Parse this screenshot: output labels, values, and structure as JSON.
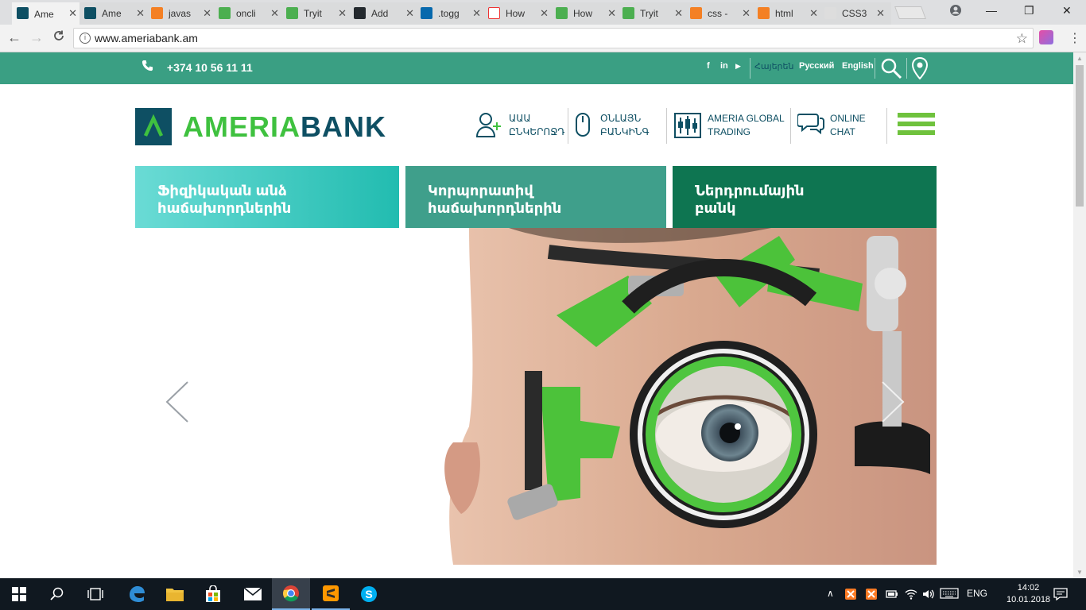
{
  "browser": {
    "tabs": [
      {
        "label": "Ame",
        "icon": "ameria-favicon",
        "active": true
      },
      {
        "label": "Ame",
        "icon": "ameria-favicon"
      },
      {
        "label": "javas",
        "icon": "stackoverflow-icon"
      },
      {
        "label": "oncli",
        "icon": "w3schools-icon"
      },
      {
        "label": "Tryit",
        "icon": "w3schools-icon"
      },
      {
        "label": "Add",
        "icon": "github-icon"
      },
      {
        "label": ".togg",
        "icon": "jquery-icon"
      },
      {
        "label": "How",
        "icon": "cv-icon"
      },
      {
        "label": "How",
        "icon": "w3schools-icon"
      },
      {
        "label": "Tryit",
        "icon": "w3schools-icon"
      },
      {
        "label": "css -",
        "icon": "stackoverflow-icon"
      },
      {
        "label": "html",
        "icon": "stackoverflow-icon"
      },
      {
        "label": "CSS3",
        "icon": "codepen-icon"
      }
    ],
    "close_glyph": "✕",
    "url": "www.ameriabank.am",
    "info_glyph": "i",
    "star_glyph": "☆",
    "menu_glyph": "⋮",
    "back_glyph": "←",
    "forward_glyph": "→",
    "reload_glyph": "C",
    "min_glyph": "—",
    "max_glyph": "❐",
    "win_close_glyph": "✕"
  },
  "topbar": {
    "phone": "+374 10 56 11 11",
    "social": [
      "f",
      "in",
      "▶"
    ],
    "languages": [
      "Հայերեն",
      "Русский",
      "English"
    ]
  },
  "header": {
    "logo_ameria": "AMERIA",
    "logo_bank": "BANK",
    "nav": [
      {
        "line1": "ԱԱԱ",
        "line2": "ԸՆԿԵՐՈՋԴ",
        "icon": "user-add-icon"
      },
      {
        "line1": "ՕՆԼԱՅՆ",
        "line2": "ԲԱՆԿԻՆԳ",
        "icon": "mouse-icon"
      },
      {
        "line1": "AMERIA GLOBAL",
        "line2": "TRADING",
        "icon": "trading-chart-icon"
      },
      {
        "line1": "ONLINE",
        "line2": "CHAT",
        "icon": "chat-icon"
      }
    ]
  },
  "categories": [
    {
      "line1": "Ֆիզիկական անձ",
      "line2": "հաճախորդներին"
    },
    {
      "line1": "Կորպորատիվ",
      "line2": "հաճախորդներին"
    },
    {
      "line1": "Ներդրումային",
      "line2": "բանկ"
    }
  ],
  "colors": {
    "brand_green": "#3a9f83",
    "brand_navy": "#0e4f63",
    "logo_green": "#3fc13f"
  },
  "taskbar": {
    "lang": "ENG",
    "time": "14:02",
    "date": "10.01.2018"
  }
}
